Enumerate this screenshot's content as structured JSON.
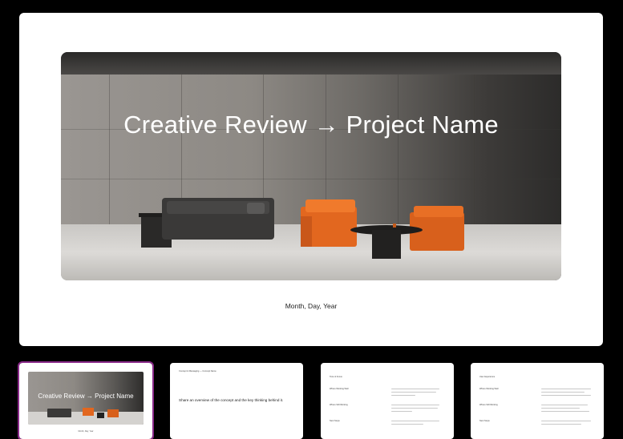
{
  "main_slide": {
    "title": "Creative Review → Project Name",
    "date": "Month, Day, Year"
  },
  "thumbnails": [
    {
      "title": "Creative Review → Project Name",
      "date": "Month, Day, Year",
      "selected": true
    },
    {
      "header": "Concept & Messaging — Concept Name",
      "body": "Share an overview of the concept and the key thinking behind it."
    },
    {
      "header": "Tone & Focus",
      "rows": [
        "Where Working Well",
        "Where Still Working",
        "Next Steps"
      ]
    },
    {
      "header": "User Experience",
      "rows": [
        "Where Working Well",
        "Where Still Working",
        "Next Steps"
      ]
    }
  ],
  "colors": {
    "sofa": "#3a3938",
    "chair": "#e2671f",
    "selection_outline": "#8a2a8a"
  }
}
